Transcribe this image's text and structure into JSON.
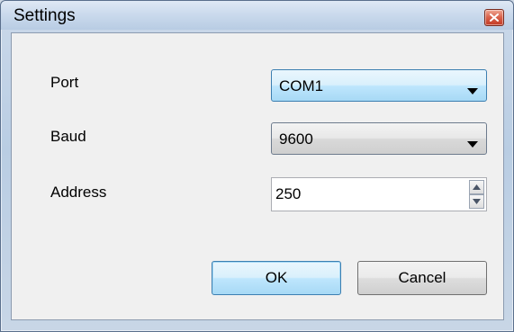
{
  "window": {
    "title": "Settings"
  },
  "fields": {
    "port": {
      "label": "Port",
      "value": "COM1"
    },
    "baud": {
      "label": "Baud",
      "value": "9600"
    },
    "address": {
      "label": "Address",
      "value": "250"
    }
  },
  "buttons": {
    "ok_label": "OK",
    "cancel_label": "Cancel"
  },
  "icons": {
    "close": "close-icon",
    "dropdown": "chevron-down-icon",
    "spin_up": "spin-up-icon",
    "spin_down": "spin-down-icon"
  },
  "colors": {
    "accent": "#3c7fb1",
    "close_red": "#c23a24",
    "client_bg": "#f0f0f0"
  }
}
